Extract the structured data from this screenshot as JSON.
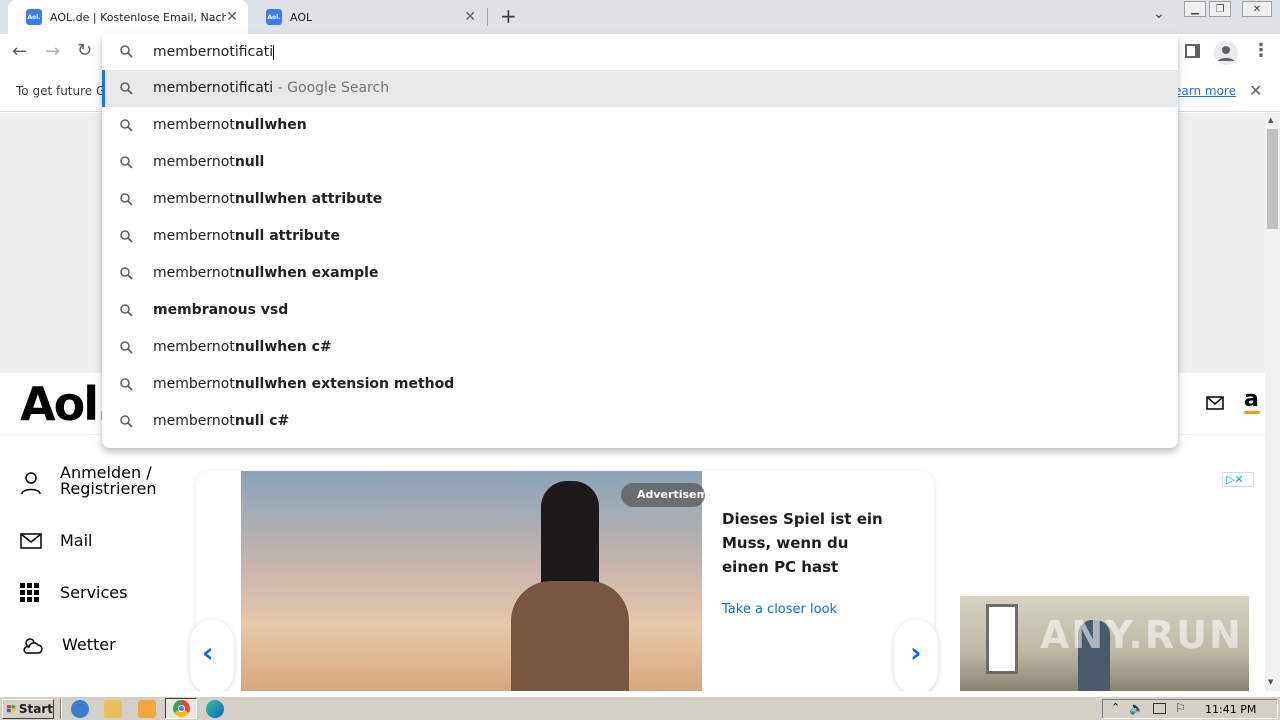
{
  "tabs": [
    {
      "title": "AOL.de | Kostenlose Email, Nachrichten",
      "favicon": "Aol.",
      "active": true
    },
    {
      "title": "AOL",
      "favicon": "Aol.",
      "active": false
    }
  ],
  "new_tab_label": "+",
  "omnibox": {
    "value": "membernotificati",
    "suggestions": [
      {
        "typed": "membernotificati",
        "bold": "",
        "suffix": " - Google Search"
      },
      {
        "typed": "membernot",
        "bold": "nullwhen",
        "suffix": ""
      },
      {
        "typed": "membernot",
        "bold": "null",
        "suffix": ""
      },
      {
        "typed": "membernot",
        "bold": "nullwhen attribute",
        "suffix": ""
      },
      {
        "typed": "membernot",
        "bold": "null attribute",
        "suffix": ""
      },
      {
        "typed": "membernot",
        "bold": "nullwhen example",
        "suffix": ""
      },
      {
        "typed": "",
        "bold": "membranous vsd",
        "suffix": ""
      },
      {
        "typed": "membernot",
        "bold": "nullwhen c#",
        "suffix": ""
      },
      {
        "typed": "membernot",
        "bold": "nullwhen extension method",
        "suffix": ""
      },
      {
        "typed": "membernot",
        "bold": "null c#",
        "suffix": ""
      }
    ]
  },
  "infobar": {
    "text": "To get future G",
    "link": "earn more"
  },
  "aol": {
    "logo": "Aol.",
    "sidebar": [
      {
        "icon": "user-icon",
        "label": "Anmelden / Registrieren"
      },
      {
        "icon": "mail-icon",
        "label": "Mail"
      },
      {
        "icon": "grid-icon",
        "label": "Services"
      },
      {
        "icon": "weather-icon",
        "label": "Wetter"
      }
    ],
    "ad": {
      "badge": "Advertisem",
      "headline": "Dieses Spiel ist ein Muss, wenn du einen PC hast",
      "cta": "Take a closer look"
    }
  },
  "watermark": "ANY.RUN",
  "taskbar": {
    "start_label": "Start",
    "clock": "11:41 PM"
  },
  "colors": {
    "accent": "#1a73e8",
    "tabstrip": "#dee1e6",
    "aol_link": "#0f69ff"
  }
}
